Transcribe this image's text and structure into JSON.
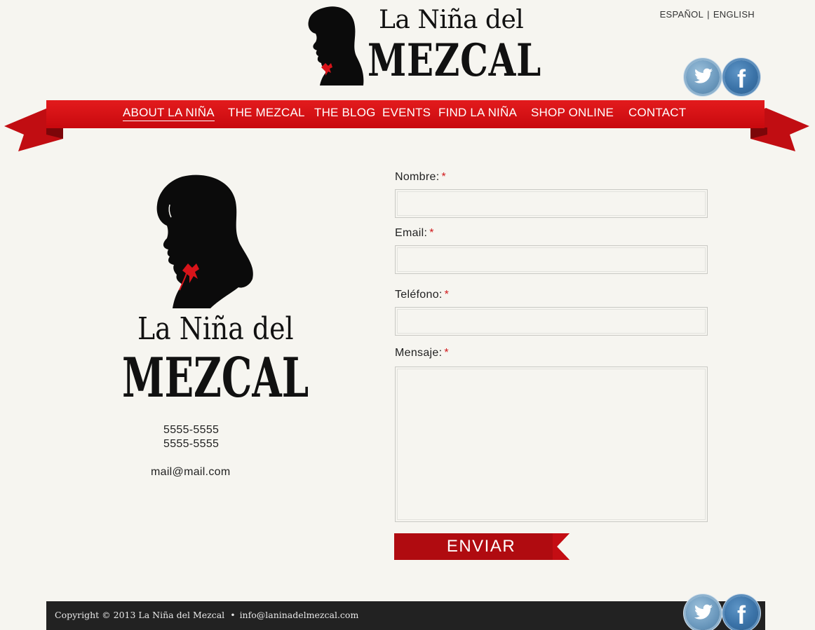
{
  "brand": {
    "line1": "La Niña del",
    "line2": "MEZCAL"
  },
  "languages": {
    "spanish": "ESPAÑOL",
    "separator": "|",
    "english": "ENGLISH"
  },
  "social": {
    "twitter_glyph": "t",
    "facebook_glyph": "f"
  },
  "nav": {
    "items": [
      {
        "label": "ABOUT LA NIÑA",
        "active": true
      },
      {
        "label": "THE MEZCAL"
      },
      {
        "label": "THE BLOG"
      },
      {
        "label": "EVENTS"
      },
      {
        "label": "FIND LA NIÑA"
      },
      {
        "label": "SHOP ONLINE"
      },
      {
        "label": "CONTACT"
      }
    ]
  },
  "contact_info": {
    "phone1": "5555-5555",
    "phone2": "5555-5555",
    "email": "mail@mail.com"
  },
  "form": {
    "required_marker": "*",
    "name_label": "Nombre:",
    "email_label": "Email:",
    "phone_label": "Teléfono:",
    "message_label": "Mensaje:",
    "submit_label": "ENVIAR"
  },
  "footer": {
    "copyright": "Copyright © 2013 La Niña del Mezcal",
    "bullet": "•",
    "email": "info@laninadelmezcal.com"
  },
  "colors": {
    "ribbon_red": "#d81117",
    "dark_red": "#a30b0f",
    "footer_bg": "#222222",
    "page_bg": "#f6f5f0",
    "twitter_blue": "#6f9cc0",
    "facebook_blue": "#3b73a8"
  }
}
